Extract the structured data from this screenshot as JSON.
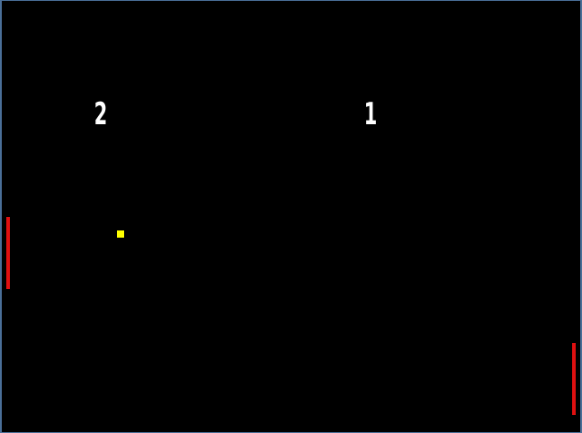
{
  "scoreboard": {
    "left_score": "2",
    "right_score": "1"
  },
  "colors": {
    "background": "#000000",
    "border": "#4a6f98",
    "paddle": "#e01010",
    "ball": "#ffff00",
    "score_text": "#ffffff"
  }
}
